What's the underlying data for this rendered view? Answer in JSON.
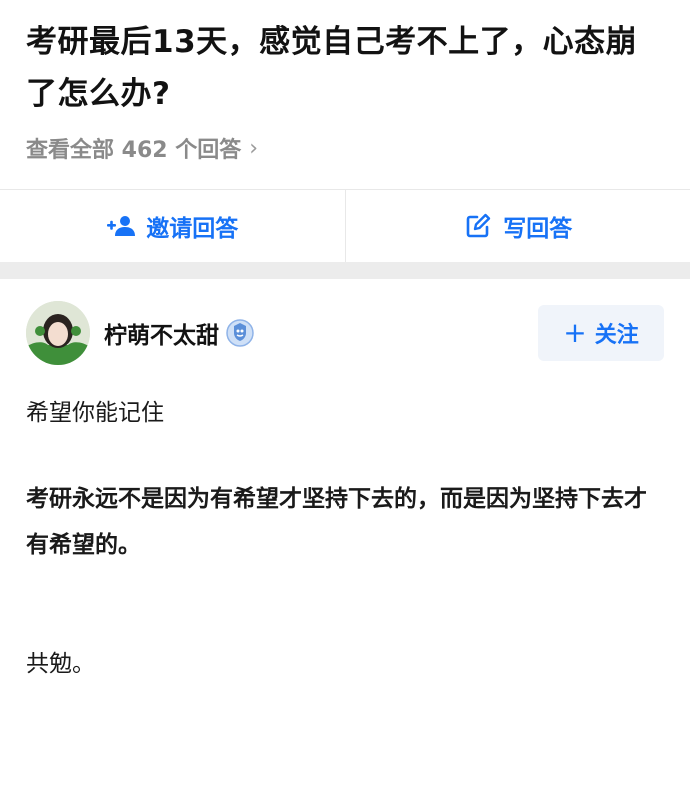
{
  "question": {
    "title": "考研最后13天，感觉自己考不上了，心态崩了怎么办?",
    "view_all": "查看全部 462 个回答",
    "chevron": "›"
  },
  "actions": {
    "invite_label": "邀请回答",
    "invite_icon": "add-person-icon",
    "write_label": "写回答",
    "write_icon": "edit-icon"
  },
  "answer": {
    "author_name": "柠萌不太甜",
    "badge_icon": "verified-badge-icon",
    "follow_label": "关注",
    "follow_plus": "+",
    "paragraphs": [
      "希望你能记住",
      "考研永远不是因为有希望才坚持下去的，而是因为坚持下去才有希望的。",
      "共勉。"
    ]
  },
  "colors": {
    "accent": "#1772f6",
    "muted": "#8a8a8a",
    "divider": "#ececec"
  }
}
